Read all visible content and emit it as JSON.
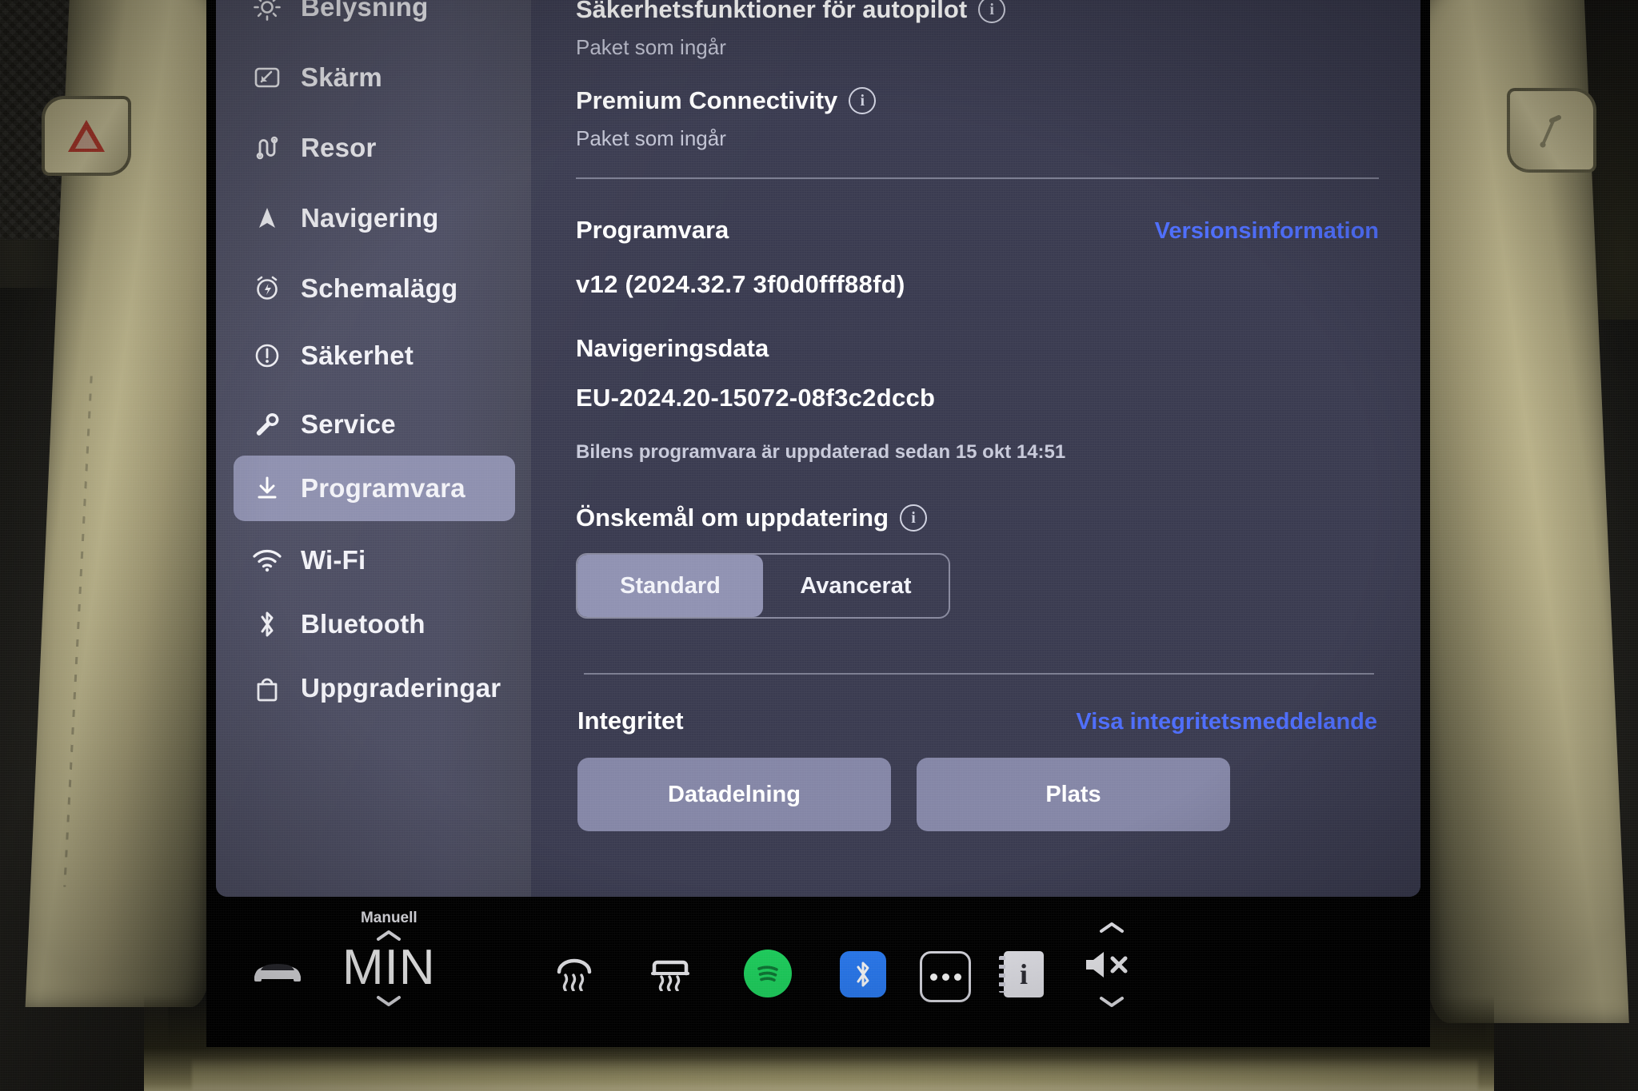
{
  "sidebar": {
    "items": [
      {
        "label": "Belysning",
        "icon": "brightness-icon",
        "active": false
      },
      {
        "label": "Skärm",
        "icon": "display-icon",
        "active": false
      },
      {
        "label": "Resor",
        "icon": "trips-icon",
        "active": false
      },
      {
        "label": "Navigering",
        "icon": "navigation-arrow-icon",
        "active": false
      },
      {
        "label": "Schemalägg",
        "icon": "alarm-clock-icon",
        "active": false
      },
      {
        "label": "Säkerhet",
        "icon": "exclamation-circle-icon",
        "active": false
      },
      {
        "label": "Service",
        "icon": "wrench-icon",
        "active": false
      },
      {
        "label": "Programvara",
        "icon": "download-icon",
        "active": true
      },
      {
        "label": "Wi-Fi",
        "icon": "wifi-icon",
        "active": false
      },
      {
        "label": "Bluetooth",
        "icon": "bluetooth-icon",
        "active": false
      },
      {
        "label": "Uppgraderingar",
        "icon": "shopping-bag-icon",
        "active": false
      }
    ]
  },
  "content": {
    "packages": [
      {
        "title": "Säkerhetsfunktioner för autopilot",
        "subtitle": "Paket som ingår",
        "info": "i"
      },
      {
        "title": "Premium Connectivity",
        "subtitle": "Paket som ingår",
        "info": "i"
      }
    ],
    "software": {
      "title": "Programvara",
      "release_notes_link": "Versionsinformation",
      "version": "v12 (2024.32.7 3f0d0fff88fd)",
      "nav_data_title": "Navigeringsdata",
      "nav_data_value": "EU-2024.20-15072-08f3c2dccb",
      "status": "Bilens programvara är uppdaterad sedan 15 okt 14:51"
    },
    "update_pref": {
      "title": "Önskemål om uppdatering",
      "info": "i",
      "options": [
        {
          "label": "Standard",
          "selected": true
        },
        {
          "label": "Avancerat",
          "selected": false
        }
      ]
    },
    "privacy": {
      "title": "Integritet",
      "link": "Visa integritetsmeddelande",
      "buttons": [
        {
          "label": "Datadelning"
        },
        {
          "label": "Plats"
        }
      ]
    }
  },
  "taskbar": {
    "car_icon": "car-icon",
    "climate": {
      "mode_label": "Manuell",
      "temperature": "MIN",
      "up_icon": "chevron-up-icon",
      "down_icon": "chevron-down-icon"
    },
    "items": [
      {
        "name": "rear-defrost-icon",
        "label": ""
      },
      {
        "name": "front-defrost-icon",
        "label": ""
      },
      {
        "name": "spotify-icon",
        "label": ""
      },
      {
        "name": "bluetooth-icon",
        "label": ""
      },
      {
        "name": "more-options-icon",
        "label": ""
      },
      {
        "name": "glovebox-icon",
        "label": "i"
      }
    ],
    "volume": {
      "mute_icon": "volume-mute-icon",
      "up_icon": "chevron-up-icon",
      "down_icon": "chevron-down-icon"
    }
  },
  "colors": {
    "screen_bg": "#3a3b50",
    "sidebar_bg": "#4b4c61",
    "accent_link": "#4d6dfb",
    "selected_pill": "#8d8fae",
    "button_fill": "#8486a6",
    "spotify_green": "#1ed760",
    "bluetooth_blue": "#2a7cf6"
  }
}
